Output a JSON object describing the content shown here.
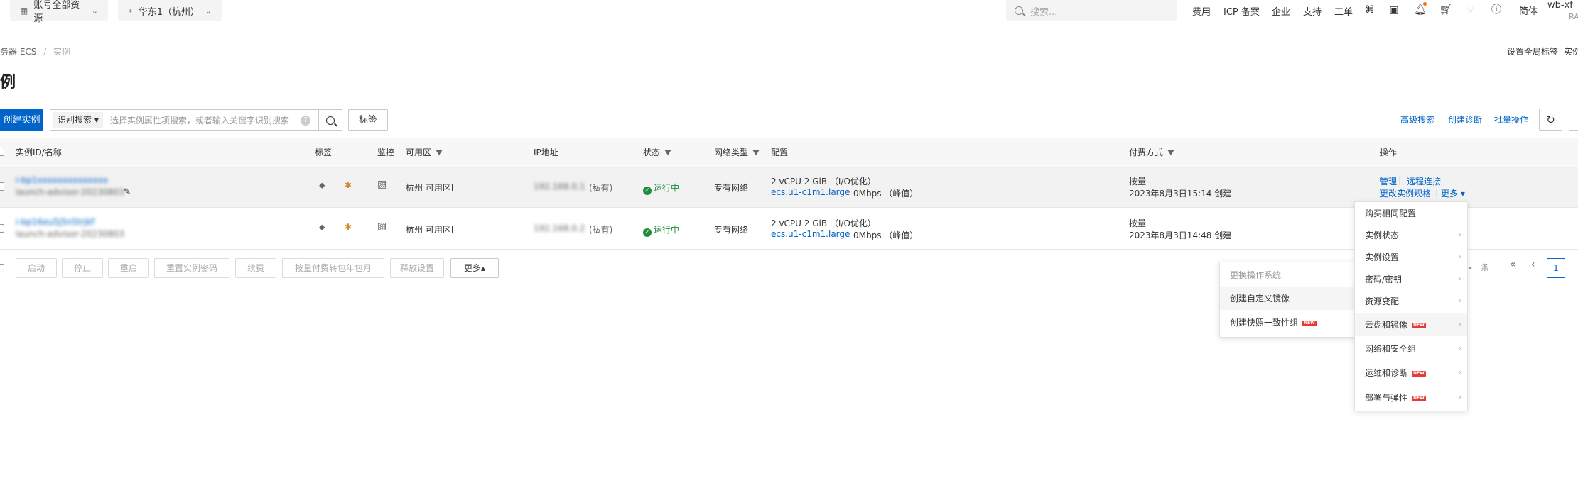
{
  "topbar": {
    "account_resources": "账号全部资源",
    "region": "华东1（杭州）",
    "search_placeholder": "搜索...",
    "links": [
      "费用",
      "ICP 备案",
      "企业",
      "支持",
      "工单"
    ],
    "language": "简体",
    "user_name": "wb-xf",
    "user_sub": "RA"
  },
  "breadcrumb": {
    "parent": "务器 ECS",
    "separator": "/",
    "current": "实例"
  },
  "page_actions": {
    "global_tags": "设置全局标签",
    "right_cut": "实例"
  },
  "page_title": "例",
  "toolbar": {
    "create_label": "创建实例",
    "search_mode": "识别搜索",
    "search_placeholder": "选择实例属性项搜索，或者输入关键字识别搜索",
    "help": "?",
    "tags_button": "标签",
    "advanced_search": "高级搜索",
    "create_diagnosis": "创建诊断",
    "batch_ops": "批量操作"
  },
  "table": {
    "headers": {
      "id_name": "实例ID/名称",
      "tags": "标签",
      "monitor": "监控",
      "zone": "可用区",
      "ip": "IP地址",
      "status": "状态",
      "network": "网络类型",
      "config": "配置",
      "billing": "付费方式",
      "ops": "操作"
    },
    "rows": [
      {
        "id": "i-bp1xxxxxxxxxxxxxx",
        "name": "launch-advisor-20230803",
        "zone": "杭州 可用区I",
        "ip": "192.168.0.1",
        "ip_suffix": "(私有)",
        "status": "运行中",
        "network": "专有网络",
        "config_line1": "2 vCPU 2 GiB （I/O优化）",
        "instance_type": "ecs.u1-c1m1.large",
        "bandwidth": "0Mbps （峰值）",
        "billing": "按量",
        "created": "2023年8月3日15:14 创建",
        "op_manage": "管理",
        "op_remote": "远程连接",
        "op_change_spec": "更改实例规格",
        "op_more": "更多"
      },
      {
        "id": "i-bp16eu5j5n5trjkf",
        "name": "launch-advisor-20230803",
        "zone": "杭州 可用区I",
        "ip": "192.168.0.2",
        "ip_suffix": "(私有)",
        "status": "运行中",
        "network": "专有网络",
        "config_line1": "2 vCPU 2 GiB （I/O优化）",
        "instance_type": "ecs.u1-c1m1.large",
        "bandwidth": "0Mbps （峰值）",
        "billing": "按量",
        "created": "2023年8月3日14:48 创建"
      }
    ]
  },
  "bottom_actions": [
    "启动",
    "停止",
    "重启",
    "重置实例密码",
    "续费",
    "按量付费转包年包月",
    "释放设置",
    "更多"
  ],
  "pagination": {
    "unit": "条",
    "current_page": "1"
  },
  "more_menu": {
    "items": [
      {
        "label": "购买相同配置",
        "submenu": false,
        "new": false
      },
      {
        "label": "实例状态",
        "submenu": true,
        "new": false
      },
      {
        "label": "实例设置",
        "submenu": true,
        "new": false
      },
      {
        "label": "密码/密钥",
        "submenu": true,
        "new": false
      },
      {
        "label": "资源变配",
        "submenu": true,
        "new": false
      },
      {
        "label": "云盘和镜像",
        "submenu": true,
        "new": true
      },
      {
        "label": "网络和安全组",
        "submenu": true,
        "new": false
      },
      {
        "label": "运维和诊断",
        "submenu": true,
        "new": true
      },
      {
        "label": "部署与弹性",
        "submenu": true,
        "new": true
      }
    ]
  },
  "sub_menu": {
    "items": [
      {
        "label": "更换操作系统",
        "disabled": true,
        "new": false
      },
      {
        "label": "创建自定义镜像",
        "disabled": false,
        "new": false
      },
      {
        "label": "创建快照一致性组",
        "disabled": false,
        "new": true
      }
    ]
  },
  "badge_text": "NEW",
  "colors": {
    "primary": "#0064c8",
    "success": "#1e8e3e",
    "badge": "#e23c39",
    "notify_dot": "#ff6a00"
  }
}
